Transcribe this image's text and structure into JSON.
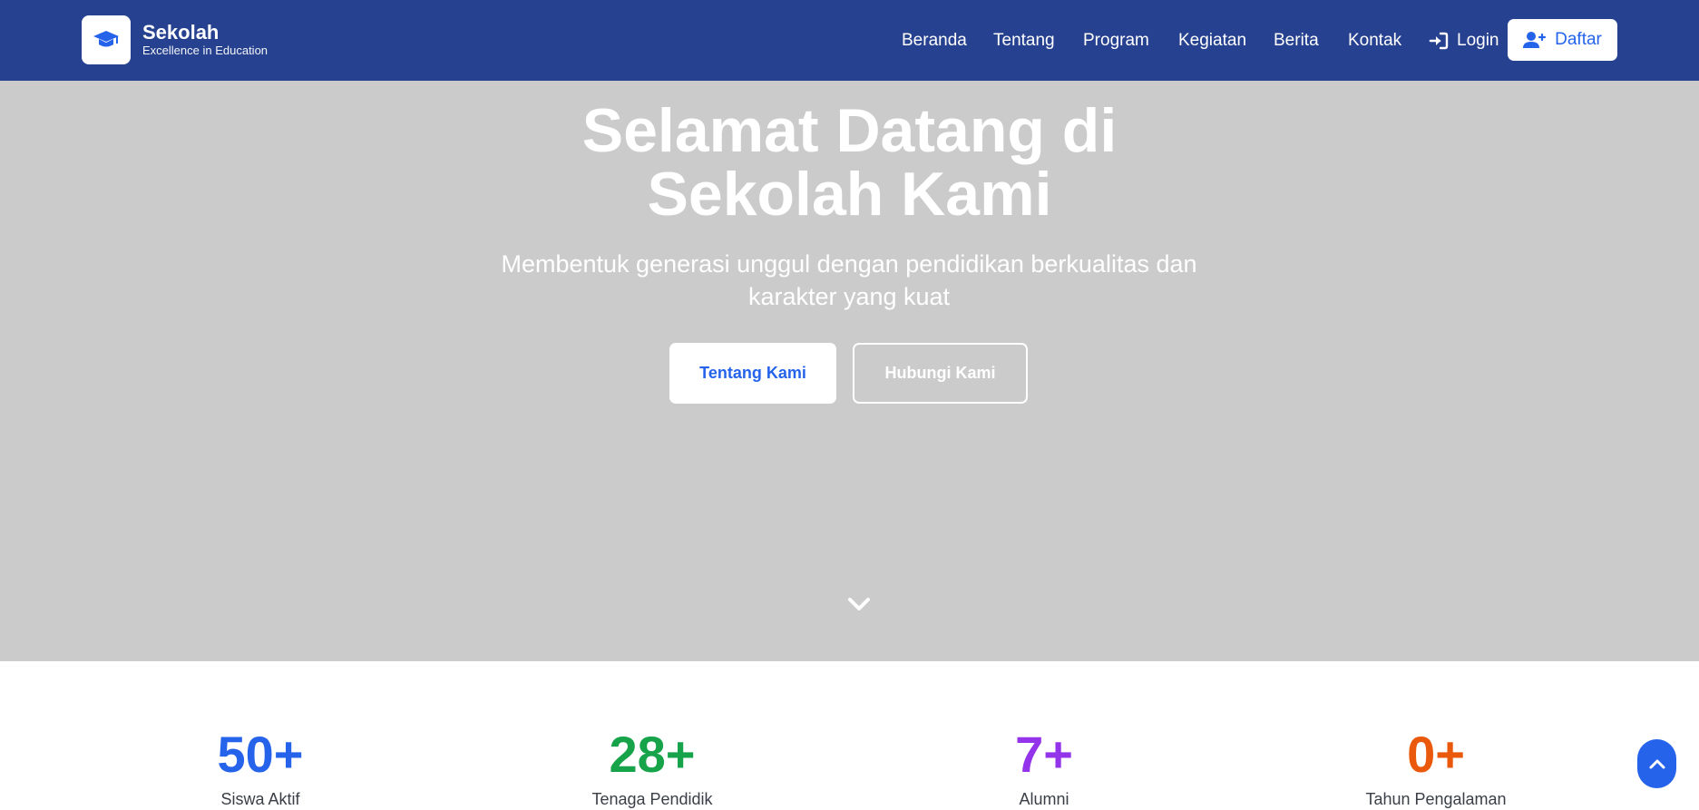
{
  "brand": {
    "name": "Sekolah",
    "tagline": "Excellence in Education",
    "logo_icon": "graduation-cap-icon"
  },
  "nav": {
    "items": [
      "Beranda",
      "Tentang",
      "Program",
      "Kegiatan",
      "Berita",
      "Kontak"
    ],
    "login_label": "Login",
    "register_label": "Daftar"
  },
  "hero": {
    "title_line1": "Selamat Datang di",
    "title_line2": "Sekolah Kami",
    "subtitle_line1": "Membentuk generasi unggul dengan pendidikan berkualitas dan",
    "subtitle_line2": "karakter yang kuat",
    "primary_button": "Tentang Kami",
    "secondary_button": "Hubungi Kami"
  },
  "stats": [
    {
      "value": "50+",
      "label": "Siswa Aktif",
      "color": "#2563eb"
    },
    {
      "value": "28+",
      "label": "Tenaga Pendidik",
      "color": "#16a34a"
    },
    {
      "value": "7+",
      "label": "Alumni",
      "color": "#9333ea"
    },
    {
      "value": "0+",
      "label": "Tahun Pengalaman",
      "color": "#ea580c"
    }
  ],
  "colors": {
    "navbar": "#26418f",
    "hero_bg": "#cbcbcb",
    "accent": "#2563eb"
  }
}
